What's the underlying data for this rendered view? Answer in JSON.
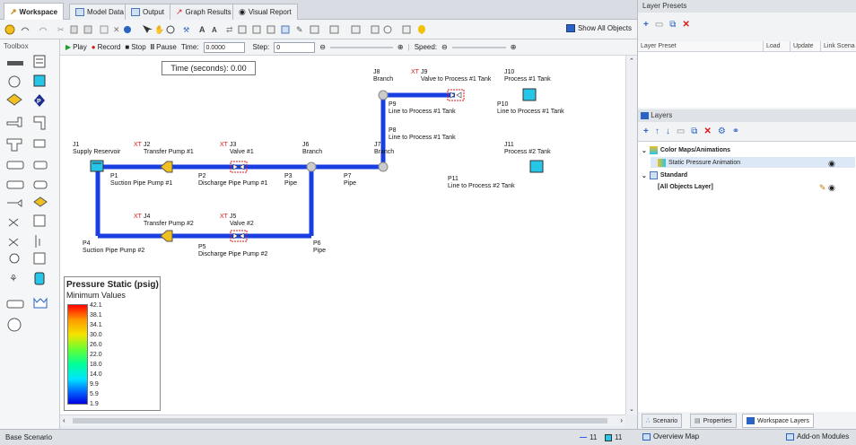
{
  "tabs": [
    {
      "label": "Workspace",
      "active": true
    },
    {
      "label": "Model Data",
      "active": false
    },
    {
      "label": "Output",
      "active": false
    },
    {
      "label": "Graph Results",
      "active": false
    },
    {
      "label": "Visual Report",
      "active": false
    }
  ],
  "toolbar": {
    "show_all_label": "Show All Objects"
  },
  "toolbox": {
    "title": "Toolbox"
  },
  "sim": {
    "play": "Play",
    "record": "Record",
    "stop": "Stop",
    "pause": "Pause",
    "time_label": "Time:",
    "time_value": "0.0000",
    "step_label": "Step:",
    "step_value": "0",
    "speed_label": "Speed:"
  },
  "canvas": {
    "time_readout": "Time (seconds): 0.00",
    "nodes": {
      "j1": {
        "id": "J1",
        "name": "Supply Reservoir"
      },
      "j2": {
        "xt": "XT",
        "id": "J2",
        "name": "Transfer Pump #1"
      },
      "j3": {
        "xt": "XT",
        "id": "J3",
        "name": "Valve #1"
      },
      "j4": {
        "xt": "XT",
        "id": "J4",
        "name": "Transfer Pump #2"
      },
      "j5": {
        "xt": "XT",
        "id": "J5",
        "name": "Valve #2"
      },
      "j6": {
        "id": "J6",
        "name": "Branch"
      },
      "j7": {
        "id": "J7",
        "name": "Branch"
      },
      "j8": {
        "id": "J8",
        "name": "Branch"
      },
      "j9": {
        "xt": "XT",
        "id": "J9",
        "name": "Valve to Process #1 Tank"
      },
      "j10": {
        "id": "J10",
        "name": "Process #1 Tank"
      },
      "j11": {
        "id": "J11",
        "name": "Process #2 Tank"
      }
    },
    "pipes": {
      "p1": {
        "id": "P1",
        "name": "Suction Pipe Pump #1"
      },
      "p2": {
        "id": "P2",
        "name": "Discharge Pipe Pump #1"
      },
      "p3": {
        "id": "P3",
        "name": "Pipe"
      },
      "p4": {
        "id": "P4",
        "name": "Suction Pipe Pump #2"
      },
      "p5": {
        "id": "P5",
        "name": "Discharge Pipe Pump #2"
      },
      "p6": {
        "id": "P6",
        "name": "Pipe"
      },
      "p7": {
        "id": "P7",
        "name": "Pipe"
      },
      "p8": {
        "id": "P8",
        "name": "Line to Process #1 Tank"
      },
      "p9": {
        "id": "P9",
        "name": "Line to Process #1 Tank"
      },
      "p10": {
        "id": "P10",
        "name": "Line to Process #1 Tank"
      },
      "p11": {
        "id": "P11",
        "name": "Line to Process #2 Tank"
      }
    },
    "legend": {
      "title": "Pressure Static (psig)",
      "subtitle": "Minimum Values",
      "values": [
        "42.1",
        "38.1",
        "34.1",
        "30.0",
        "26.0",
        "22.0",
        "18.0",
        "14.0",
        "9.9",
        "5.9",
        "1.9"
      ]
    }
  },
  "status": {
    "scenario": "Base Scenario",
    "pipes_count": "11",
    "junctions_count": "11",
    "overview_map": "Overview Map",
    "addon": "Add-on Modules"
  },
  "right_panel": {
    "presets_title": "Layer Presets",
    "grid_headers": [
      "Layer Preset",
      "Load",
      "Update",
      "Link Scena"
    ],
    "layers_title": "Layers",
    "tree": {
      "group1": "Color Maps/Animations",
      "item1": "Static Pressure Animation",
      "group2": "Standard",
      "item2": "[All Objects Layer]"
    },
    "bottom_tabs": [
      "Scenario",
      "Properties",
      "Workspace Layers"
    ]
  },
  "colors": {
    "pipe": "#1a3fe0",
    "accent": "#2a63c4",
    "record": "#d61b1b"
  }
}
